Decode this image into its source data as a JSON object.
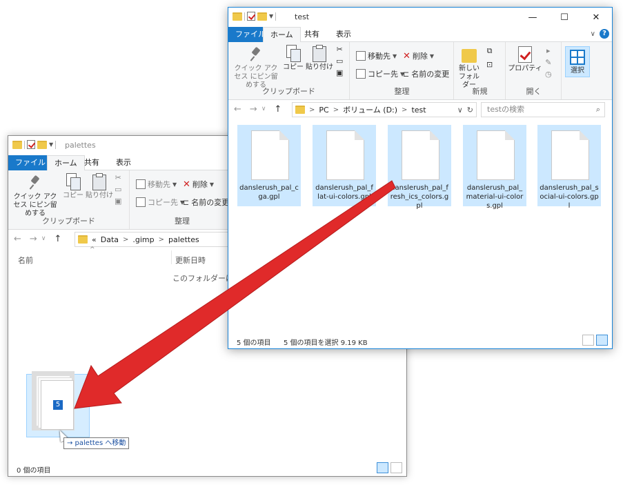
{
  "back_window": {
    "title": "palettes",
    "tabs": {
      "file": "ファイル",
      "home": "ホーム",
      "share": "共有",
      "view": "表示"
    },
    "ribbon": {
      "quick_access": "クイック アクセス にピン留めする",
      "copy": "コピー",
      "paste": "貼り付け",
      "move_to": "移動先",
      "copy_to": "コピー先",
      "delete": "削除",
      "rename": "名前の変更",
      "group_clipboard": "クリップボード",
      "group_organize": "整理"
    },
    "address": {
      "prefix": "«",
      "crumbs": [
        "Data",
        ".gimp",
        "palettes"
      ]
    },
    "columns": {
      "name": "名前",
      "date": "更新日時"
    },
    "empty_message": "このフォルダーは空で",
    "status": "0 個の項目"
  },
  "front_window": {
    "title": "test",
    "tabs": {
      "file": "ファイル",
      "home": "ホーム",
      "share": "共有",
      "view": "表示"
    },
    "ribbon": {
      "quick_access": "クイック アクセス にピン留めする",
      "copy": "コピー",
      "paste": "貼り付け",
      "move_to": "移動先",
      "copy_to": "コピー先",
      "delete": "削除",
      "rename": "名前の変更",
      "new_folder": "新しい フォルダー",
      "properties": "プロパティ",
      "select": "選択",
      "group_clipboard": "クリップボード",
      "group_organize": "整理",
      "group_new": "新規",
      "group_open": "開く"
    },
    "address": {
      "crumbs": [
        "PC",
        "ボリューム (D:)",
        "test"
      ]
    },
    "search_placeholder": "testの検索",
    "files": [
      {
        "name": "danslerush_pal_cga.gpl"
      },
      {
        "name": "danslerush_pal_flat-ui-colors.gpl"
      },
      {
        "name": "danslerush_pal_fresh_ics_colors.gpl"
      },
      {
        "name": "danslerush_pal_material-ui-colors.gpl"
      },
      {
        "name": "danslerush_pal_social-ui-colors.gpl"
      }
    ],
    "status_count": "5 個の項目",
    "status_selected": "5 個の項目を選択 9.19 KB"
  },
  "drag": {
    "count": "5",
    "tooltip": "→ palettes へ移動"
  },
  "colors": {
    "accent": "#1979ca",
    "selection": "#cce8ff",
    "arrow": "#e02a2a"
  }
}
